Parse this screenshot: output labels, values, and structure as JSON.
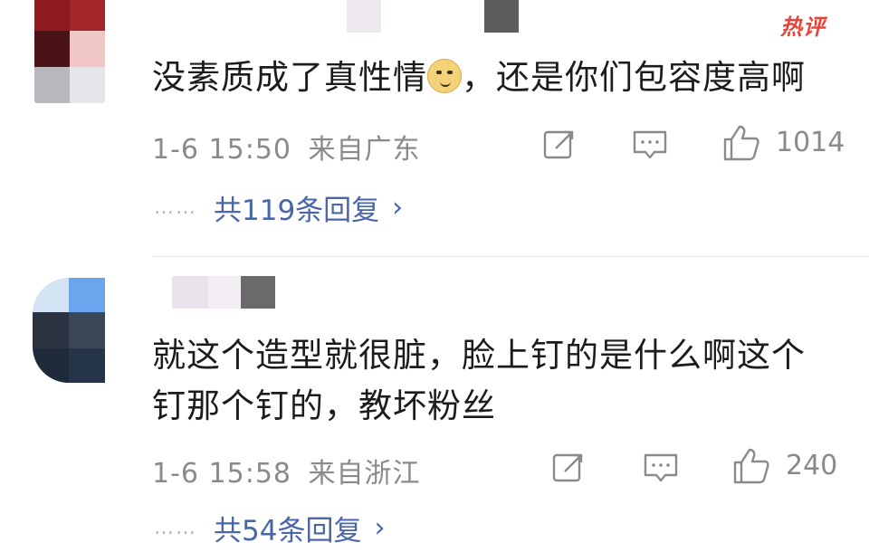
{
  "comments": [
    {
      "badge": "热评",
      "text_before_emoji": "没素质成了真性情",
      "emoji": "doge-emoji",
      "text_after_emoji": "，还是你们包容度高啊",
      "date": "1-6 15:50",
      "location": "来自广东",
      "likes": "1014",
      "replies_label": "共119条回复",
      "replies_dots": "……"
    },
    {
      "text": "就这个造型就很脏，脸上钉的是什么啊这个钉那个钉的，教坏粉丝",
      "date": "1-6 15:58",
      "location": "来自浙江",
      "likes": "240",
      "replies_label": "共54条回复",
      "replies_dots": "……"
    }
  ],
  "icons": {
    "share": "share-icon",
    "comment": "comment-icon",
    "like": "thumbs-up-icon",
    "chevron": "chevron-right-icon"
  },
  "colors": {
    "badge": "#e6453a",
    "reply_link": "#4a66a8",
    "meta": "#8a8a8a"
  }
}
